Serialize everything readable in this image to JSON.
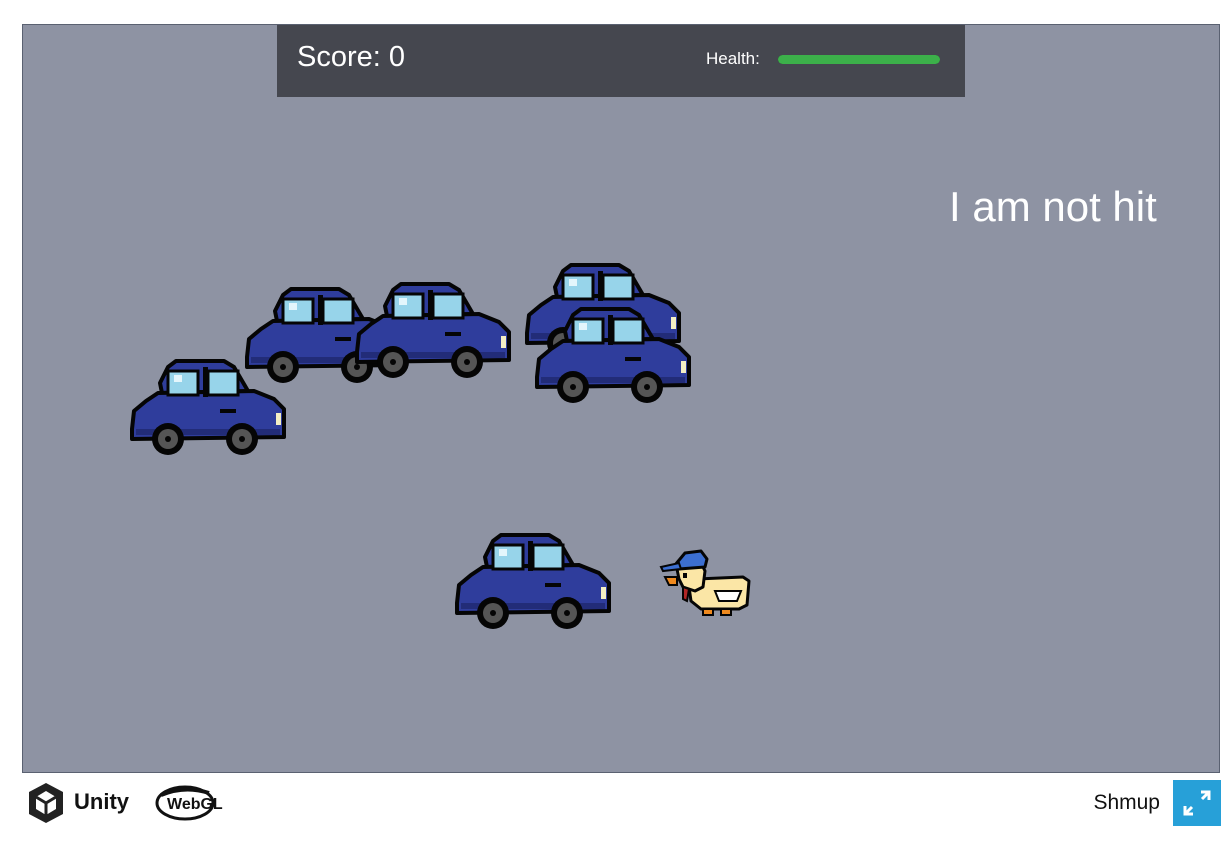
{
  "hud": {
    "score_text": "Score: 0",
    "health_label": "Health:",
    "health_fraction": 1.0,
    "health_color": "#3cb04a"
  },
  "status_text": "I am not hit",
  "canvas_color": "#8e93a3",
  "sprites": {
    "car_color": "#2f3d9c",
    "car_window_color": "#97d4ea",
    "duck_color": "#fbe6a6",
    "duck_cap_color": "#3c6fd1"
  },
  "footer": {
    "engine_name": "Unity",
    "engine_logo_icon": "unity-cube-icon",
    "platform_logo": "webgl-logo",
    "platform_text": "WebGL",
    "game_title": "Shmup",
    "fullscreen_icon": "fullscreen-expand-icon"
  }
}
